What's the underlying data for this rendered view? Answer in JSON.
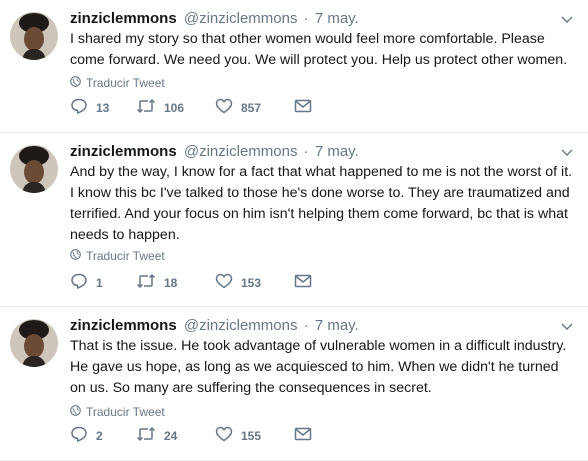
{
  "tweets": [
    {
      "name": "zinziclemmons",
      "handle": "@zinziclemmons",
      "date": "7 may.",
      "text_lines": [
        "I shared my story so that other women would feel more comfortable. Please",
        "come forward. We need you. We will protect you. Help us protect other women."
      ],
      "translate": "Traducir Tweet",
      "replies": "13",
      "retweets": "106",
      "likes": "857"
    },
    {
      "name": "zinziclemmons",
      "handle": "@zinziclemmons",
      "date": "7 may.",
      "text_lines": [
        "And by the way, I know for a fact that what happened to me is not the worst of it.",
        "I know this bc I've talked to those he's done worse to. They are traumatized and",
        "terrified. And your focus on him isn't helping them come forward, bc that is what",
        "needs to happen."
      ],
      "translate": "Traducir Tweet",
      "replies": "1",
      "retweets": "18",
      "likes": "153"
    },
    {
      "name": "zinziclemmons",
      "handle": "@zinziclemmons",
      "date": "7 may.",
      "text_lines": [
        "That is the issue. He took advantage of vulnerable women in a difficult industry.",
        "He gave us hope, as long as we acquiesced to him. When we didn't he turned",
        "on us. So many are suffering the consequences in secret."
      ],
      "translate": "Traducir Tweet",
      "replies": "2",
      "retweets": "24",
      "likes": "155"
    }
  ],
  "colors": {
    "text": "#14171a",
    "muted": "#657786",
    "divider": "#e6ecf0"
  },
  "icons": [
    "reply-icon",
    "retweet-icon",
    "like-icon",
    "message-icon",
    "globe-icon",
    "chevron-down-icon"
  ]
}
